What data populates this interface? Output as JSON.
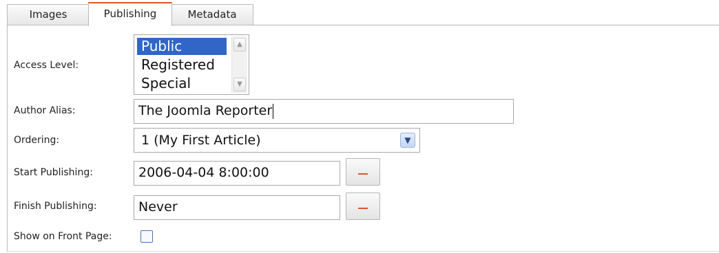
{
  "tabs": [
    {
      "label": "Images",
      "active": false
    },
    {
      "label": "Publishing",
      "active": true
    },
    {
      "label": "Metadata",
      "active": false
    }
  ],
  "form": {
    "access_level": {
      "label": "Access Level:",
      "options": [
        "Public",
        "Registered",
        "Special"
      ],
      "selected": "Public"
    },
    "author_alias": {
      "label": "Author Alias:",
      "value": "The Joomla Reporter"
    },
    "ordering": {
      "label": "Ordering:",
      "value": "1 (My First Article)"
    },
    "start_publishing": {
      "label": "Start Publishing:",
      "value": "2006-04-04 8:00:00"
    },
    "finish_publishing": {
      "label": "Finish Publishing:",
      "value": "Never"
    },
    "front_page": {
      "label": "Show on Front Page:",
      "checked": false
    }
  },
  "icons": {
    "select_arrow": "chevron-down-icon",
    "calendar": "calendar-icon",
    "scroll_up": "scroll-up-icon",
    "scroll_down": "scroll-down-icon"
  },
  "colors": {
    "active_tab_accent": "#e0512a",
    "selection": "#3166c8",
    "calendar_icon": "#e0512a"
  }
}
